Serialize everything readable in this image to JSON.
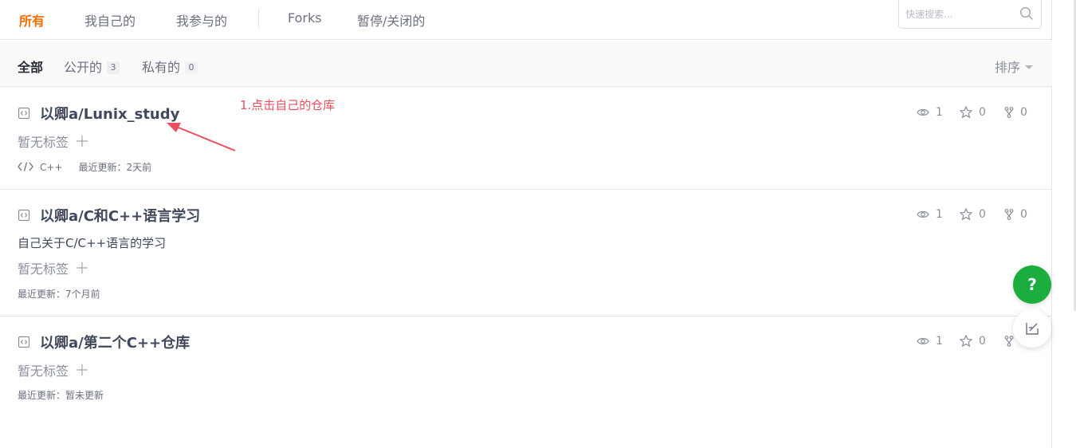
{
  "top_tabs": [
    {
      "label": "所有",
      "active": true
    },
    {
      "label": "我自己的",
      "active": false
    },
    {
      "label": "我参与的",
      "active": false
    },
    {
      "label": "Forks",
      "active": false
    },
    {
      "label": "暂停/关闭的",
      "active": false
    }
  ],
  "search": {
    "placeholder": "快速搜索..."
  },
  "sub_tabs": [
    {
      "label": "全部",
      "count": null,
      "active": true
    },
    {
      "label": "公开的",
      "count": "3",
      "active": false
    },
    {
      "label": "私有的",
      "count": "0",
      "active": false
    }
  ],
  "sort": {
    "label": "排序"
  },
  "annotation": {
    "text": "1.点击自己的仓库",
    "color": "#f04c5f"
  },
  "repos": [
    {
      "title": "以卿a/Lunix_study",
      "description": "",
      "tags_label": "暂无标签",
      "language": "C++",
      "updated": "最近更新：2天前",
      "watch": "1",
      "star": "0",
      "fork": "0"
    },
    {
      "title": "以卿a/C和C++语言学习",
      "description": "自己关于C/C++语言的学习",
      "tags_label": "暂无标签",
      "language": "",
      "updated": "最近更新：7个月前",
      "watch": "1",
      "star": "0",
      "fork": "0"
    },
    {
      "title": "以卿a/第二个C++仓库",
      "description": "",
      "tags_label": "暂无标签",
      "language": "",
      "updated": "最近更新：暂未更新",
      "watch": "1",
      "star": "0",
      "fork": ""
    }
  ],
  "floating": {
    "help_label": "?"
  },
  "colors": {
    "accent": "#f56c00",
    "help_green": "#1bad3e",
    "annotation_red": "#f04c5f"
  }
}
